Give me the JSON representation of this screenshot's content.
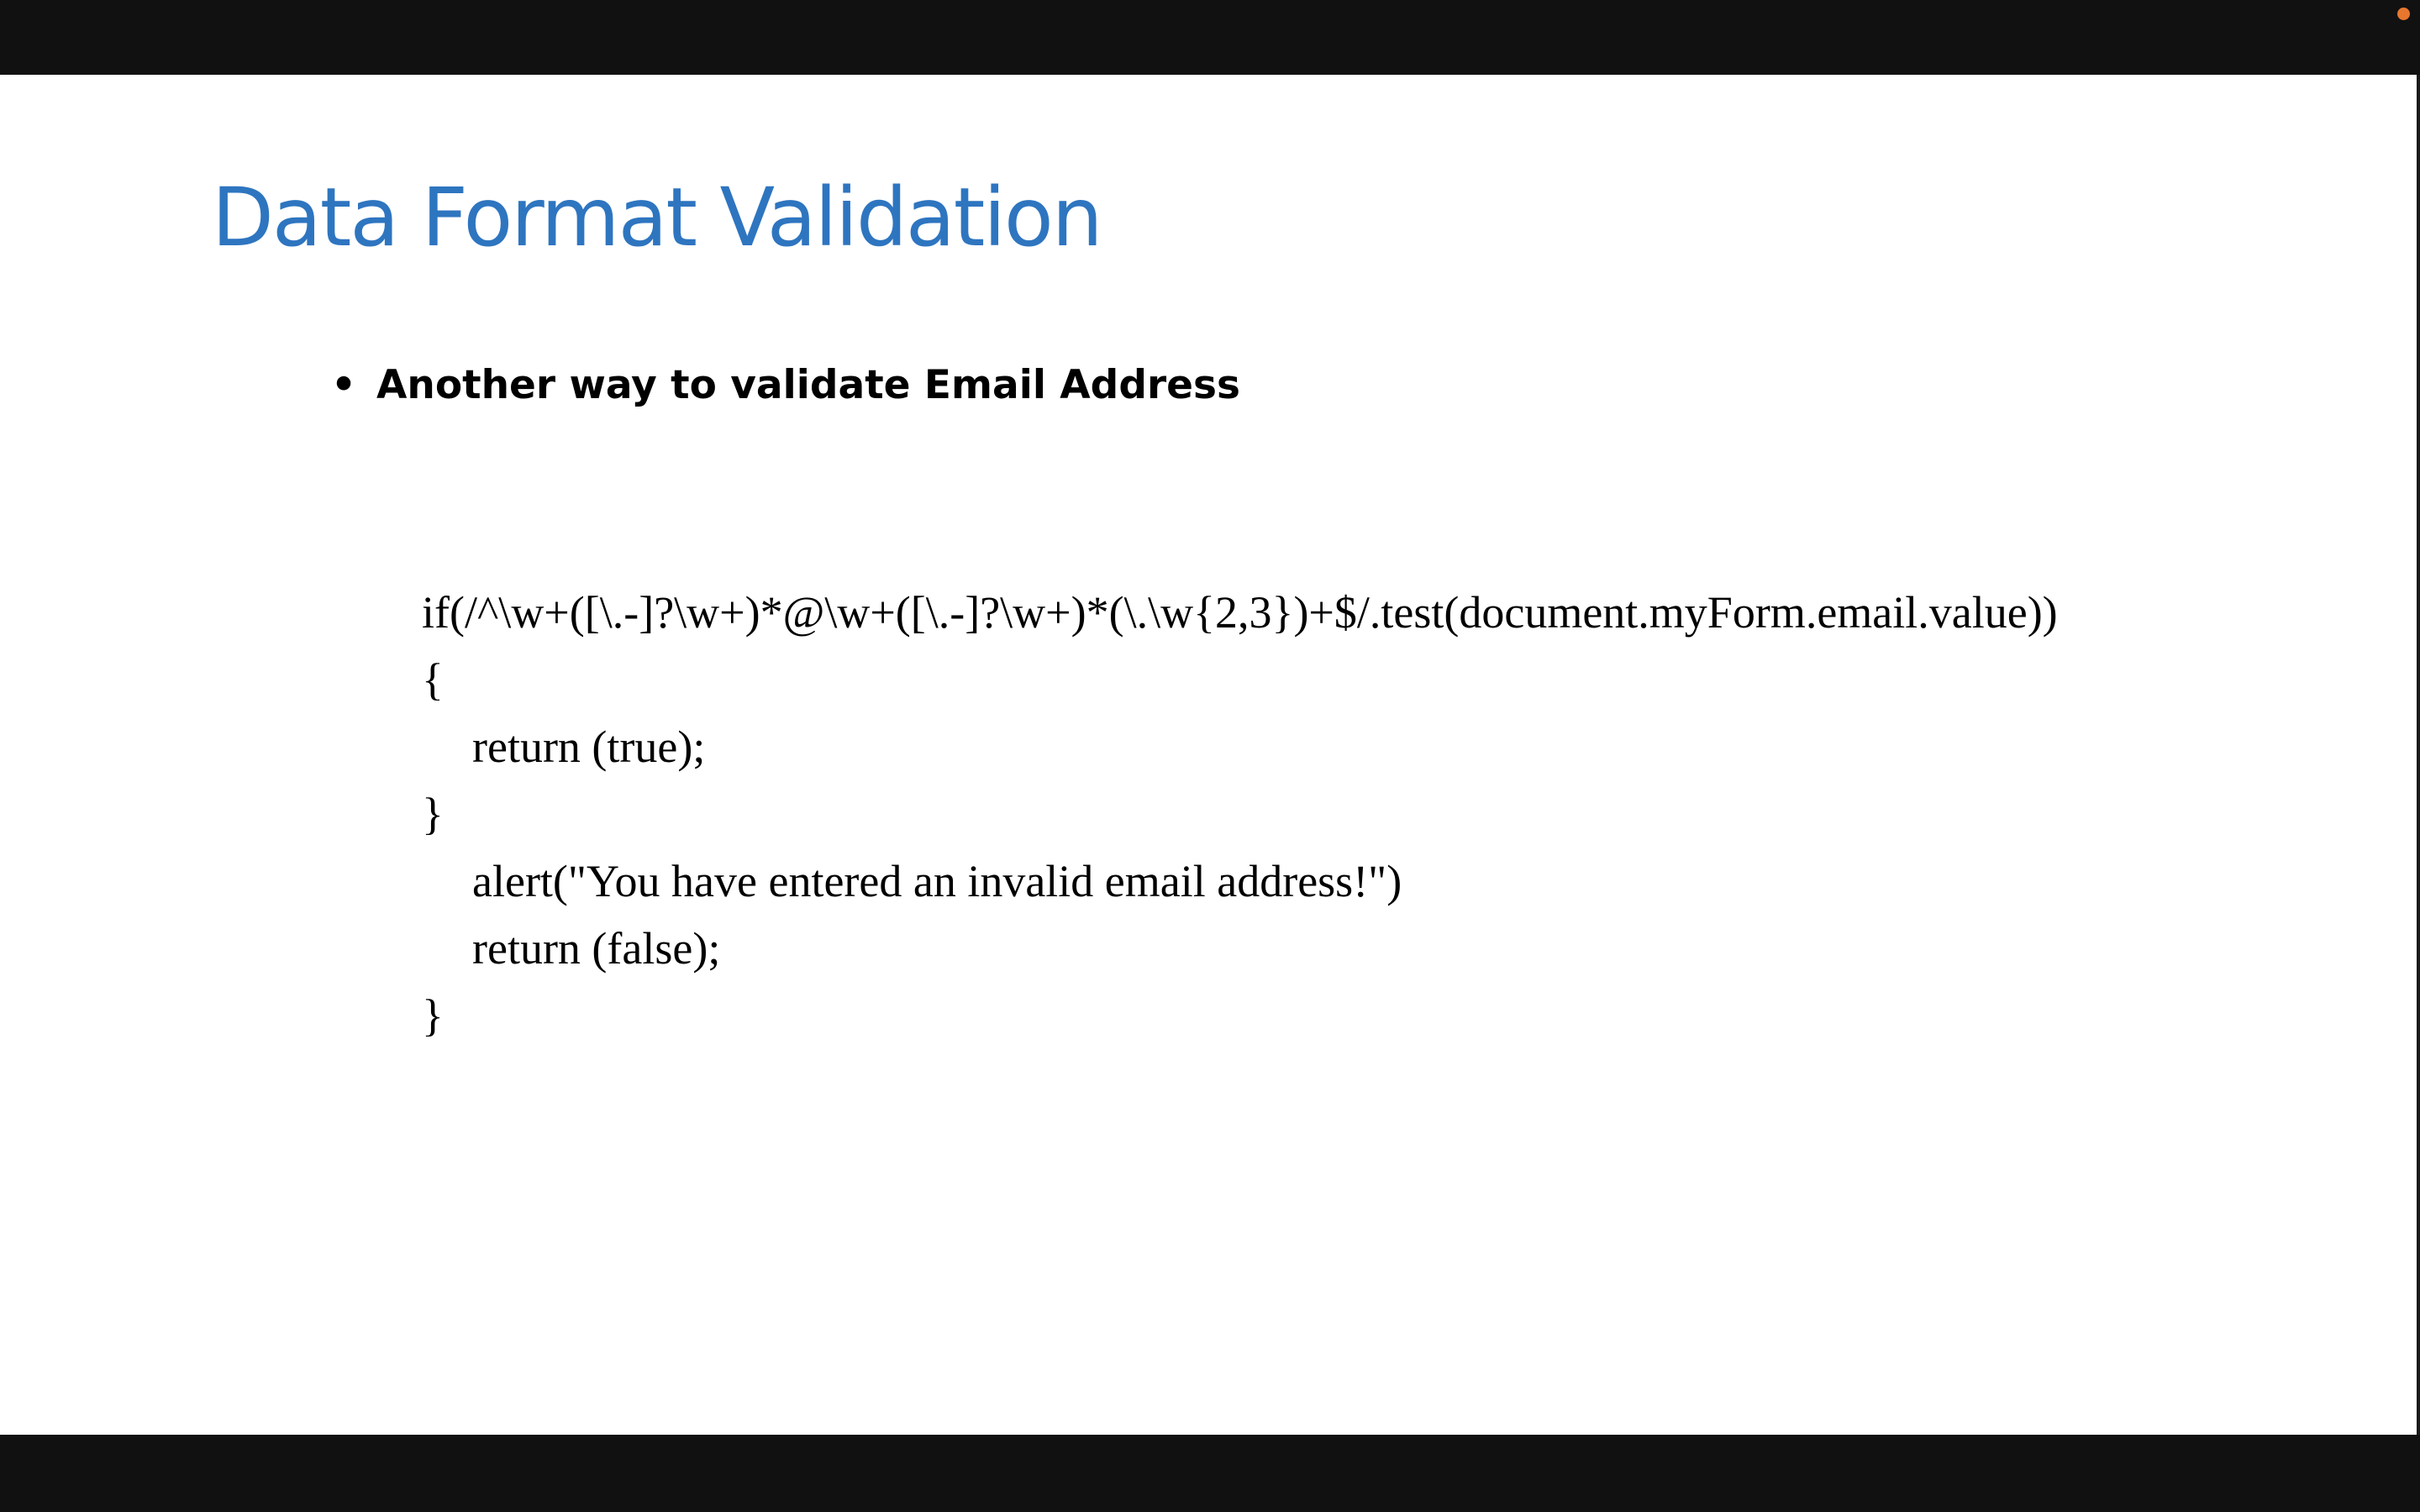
{
  "slide": {
    "title": "Data Format Validation",
    "bullet": {
      "marker": "•",
      "text": "Another way to validate Email Address"
    },
    "code": [
      {
        "text": "if(/^\\w+([\\.-]?\\w+)*@\\w+([\\.-]?\\w+)*(\\.\\w{2,3})+$/.test(document.myForm.email.value))",
        "indent": false
      },
      {
        "text": "{",
        "indent": false
      },
      {
        "text": "return (true);",
        "indent": true
      },
      {
        "text": "}",
        "indent": false
      },
      {
        "text": "alert(\"You have entered an invalid email address!\")",
        "indent": true
      },
      {
        "text": "return (false);",
        "indent": true
      },
      {
        "text": "}",
        "indent": false
      }
    ]
  },
  "colors": {
    "title": "#2e75c0",
    "frame": "#111111",
    "recording_dot": "#e8772e"
  }
}
